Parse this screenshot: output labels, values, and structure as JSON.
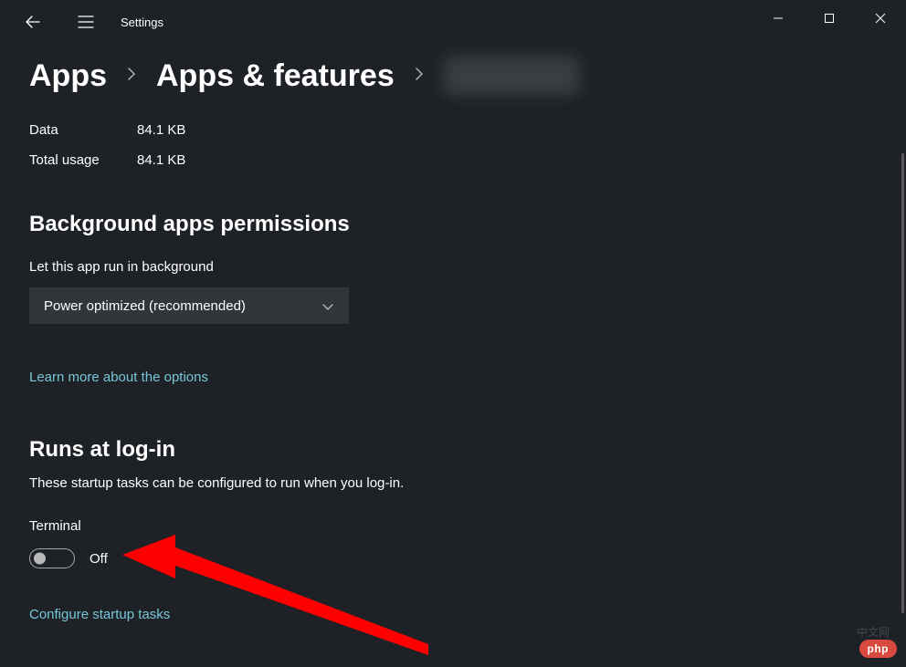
{
  "app": {
    "title": "Settings"
  },
  "breadcrumb": {
    "apps": "Apps",
    "apps_features": "Apps & features"
  },
  "storage": {
    "data_label": "Data",
    "data_value": "84.1 KB",
    "total_label": "Total usage",
    "total_value": "84.1 KB"
  },
  "background": {
    "title": "Background apps permissions",
    "label": "Let this app run in background",
    "dropdown_value": "Power optimized (recommended)",
    "learn_more": "Learn more about the options"
  },
  "startup": {
    "title": "Runs at log-in",
    "subtitle": "These startup tasks can be configured to run when you log-in.",
    "task_name": "Terminal",
    "toggle_state": "Off",
    "configure_link": "Configure startup tasks"
  },
  "badge": {
    "php": "php",
    "cn": "中文网"
  }
}
